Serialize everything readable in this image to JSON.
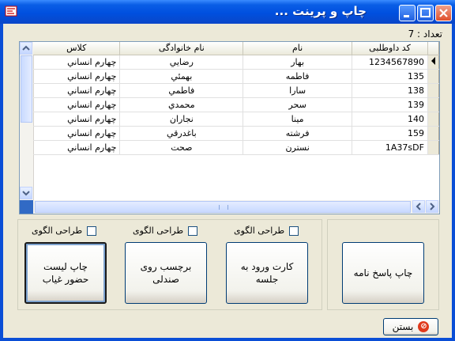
{
  "window": {
    "title": "چاپ و پرینت ..."
  },
  "count": {
    "label": "تعداد : 7"
  },
  "table": {
    "columns": [
      "کد داوطلبی",
      "نام",
      "نام خانوادگی",
      "کلاس"
    ],
    "rows": [
      {
        "code": "1234567890",
        "name": "بهار",
        "family": "رضايي",
        "klass": "چهارم انساني"
      },
      {
        "code": "135",
        "name": "فاطمه",
        "family": "بهمئي",
        "klass": "چهارم انساني"
      },
      {
        "code": "138",
        "name": "سارا",
        "family": "فاطمي",
        "klass": "چهارم انساني"
      },
      {
        "code": "139",
        "name": "سحر",
        "family": "محمدي",
        "klass": "چهارم انساني"
      },
      {
        "code": "140",
        "name": "مينا",
        "family": "نجاران",
        "klass": "چهارم انساني"
      },
      {
        "code": "159",
        "name": "فرشته",
        "family": "باغدرقي",
        "klass": "چهارم انساني"
      },
      {
        "code": "1A37sDF",
        "name": "نسترن",
        "family": "صحت",
        "klass": "چهارم انساني"
      }
    ]
  },
  "checkboxes": {
    "c1": {
      "label": "طراحی الگوی"
    },
    "c2": {
      "label": "طراحی الگوی"
    },
    "c3": {
      "label": "طراحی الگوی"
    }
  },
  "buttons": {
    "answer_sheet": "چاپ پاسخ نامه",
    "entry_card": "کارت ورود به جلسه",
    "desk_label": "برچسب روی صندلی",
    "attendance": "چاپ لیست حضور غیاب",
    "close": "بستن"
  },
  "colors": {
    "titlebar": "#0050df",
    "client": "#ece9d8",
    "selection_corner": "#316ac5"
  }
}
